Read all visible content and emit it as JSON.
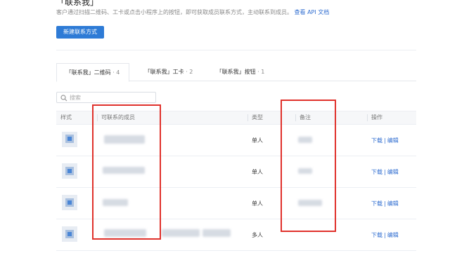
{
  "header": {
    "title": "「联系我」",
    "description": "客户通过扫描二维码、工卡或点击小程序上的按钮，即可获取成员联系方式，主动联系到成员。",
    "api_link": "查看 API 文档"
  },
  "actions": {
    "new_contact": "新建联系方式"
  },
  "tabs": [
    {
      "label": "「联系我」二维码",
      "count": "· 4",
      "active": true
    },
    {
      "label": "「联系我」工卡",
      "count": "· 2",
      "active": false
    },
    {
      "label": "「联系我」按钮",
      "count": "· 1",
      "active": false
    }
  ],
  "search": {
    "placeholder": "搜索"
  },
  "table": {
    "columns": [
      "样式",
      "可联系的成员",
      "类型",
      "备注",
      "操作"
    ],
    "rows": [
      {
        "type": "单人",
        "ops": [
          "下载",
          "编辑"
        ]
      },
      {
        "type": "单人",
        "ops": [
          "下载",
          "编辑"
        ]
      },
      {
        "type": "单人",
        "ops": [
          "下载",
          "编辑"
        ]
      },
      {
        "type": "多人",
        "ops": [
          "下载",
          "编辑"
        ]
      }
    ]
  },
  "colors": {
    "accent": "#2e7bd6",
    "link": "#2f6dd0",
    "highlight": "#e0312b"
  },
  "icons": [
    "search-icon",
    "qr-style-icon"
  ]
}
